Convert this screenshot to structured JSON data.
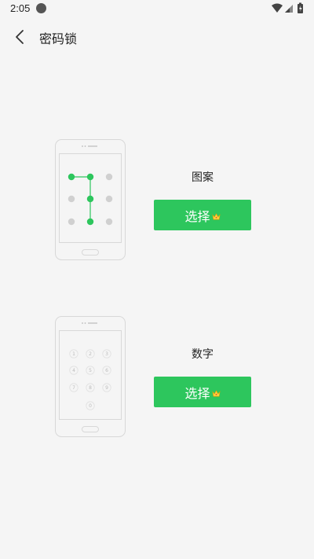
{
  "status_bar": {
    "time": "2:05"
  },
  "header": {
    "title": "密码锁"
  },
  "options": [
    {
      "label": "图案",
      "button_label": "选择"
    },
    {
      "label": "数字",
      "button_label": "选择"
    }
  ],
  "keypad": {
    "keys": [
      "1",
      "2",
      "3",
      "4",
      "5",
      "6",
      "7",
      "8",
      "9",
      "0"
    ]
  },
  "colors": {
    "accent": "#2dc65d",
    "background": "#f5f5f5"
  }
}
